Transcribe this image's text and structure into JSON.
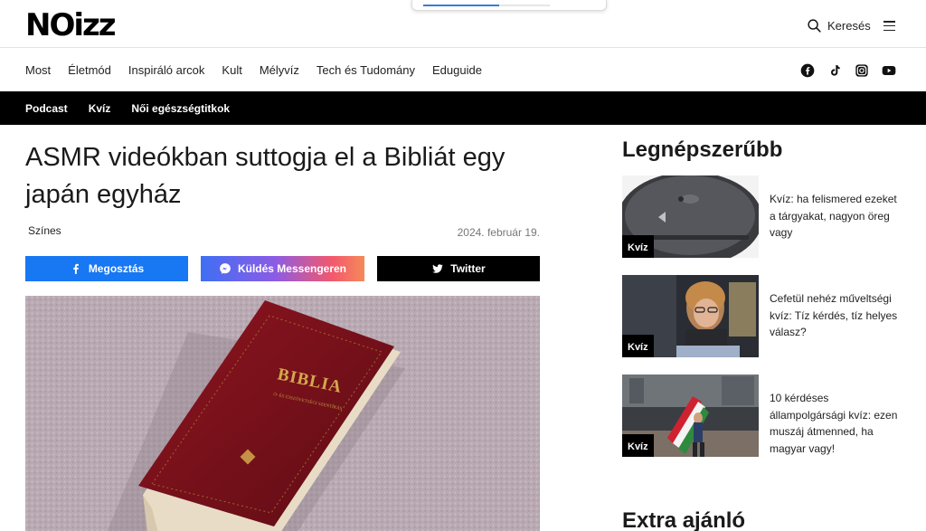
{
  "loading": {
    "progress": 0.6
  },
  "header": {
    "logo": "NOizz",
    "search_label": "Keresés"
  },
  "nav": {
    "items": [
      "Most",
      "Életmód",
      "Inspiráló arcok",
      "Kult",
      "Mélyvíz",
      "Tech és Tudomány",
      "Eduguide"
    ]
  },
  "social": {
    "icons": [
      "facebook-icon",
      "tiktok-icon",
      "instagram-icon",
      "youtube-icon"
    ]
  },
  "subnav": {
    "items": [
      "Podcast",
      "Kvíz",
      "Női egészségtitkok"
    ]
  },
  "article": {
    "title": "ASMR videókban suttogja el a Bibliát egy japán egyház",
    "category": "Színes",
    "date": "2024. február 19.",
    "hero_alt_text": "BIBLIA",
    "hero_sub_text": "Ó- ÉS ÚJSZÖVETSÉGI SZENTÍRÁS"
  },
  "share": {
    "facebook": "Megosztás",
    "messenger": "Küldés Messengeren",
    "twitter": "Twitter"
  },
  "sidebar": {
    "title": "Legnépszerűbb",
    "cards": [
      {
        "badge": "Kvíz",
        "text": "Kvíz: ha felismered ezeket a tárgyakat, nagyon öreg vagy"
      },
      {
        "badge": "Kvíz",
        "text": "Cefetül nehéz műveltségi kvíz: Tíz kérdés, tíz helyes válasz?"
      },
      {
        "badge": "Kvíz",
        "text": "10 kérdéses állampolgársági kvíz: ezen muszáj átmenned, ha magyar vagy!"
      }
    ],
    "extra_title": "Extra ajánló"
  },
  "colors": {
    "facebook": "#1877f2",
    "twitter": "#000000",
    "subnav_bg": "#000000"
  }
}
